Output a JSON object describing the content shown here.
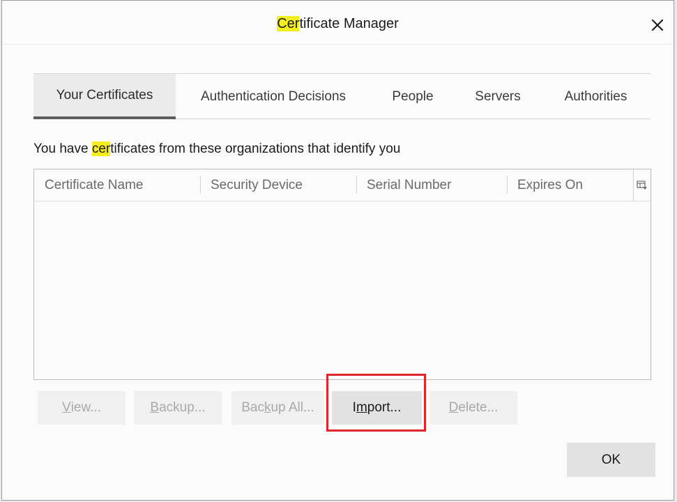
{
  "window": {
    "title_highlight": "Cer",
    "title_rest": "tificate Manager",
    "close_icon": "close-icon"
  },
  "tabs": [
    {
      "label": "Your Certificates",
      "active": true
    },
    {
      "label": "Authentication Decisions",
      "active": false
    },
    {
      "label": "People",
      "active": false
    },
    {
      "label": "Servers",
      "active": false
    },
    {
      "label": "Authorities",
      "active": false
    }
  ],
  "intro": {
    "before": "You have ",
    "highlight": "cer",
    "after": "tificates from these organizations that identify you"
  },
  "table": {
    "columns": [
      "Certificate Name",
      "Security Device",
      "Serial Number",
      "Expires On"
    ],
    "rows": [],
    "column_picker_icon": "column-picker-icon"
  },
  "buttons": {
    "view": {
      "pre": "",
      "key": "V",
      "post": "iew...",
      "enabled": false
    },
    "backup": {
      "pre": "",
      "key": "B",
      "post": "ackup...",
      "enabled": false
    },
    "backup_all": {
      "pre": "Bac",
      "key": "k",
      "post": "up All...",
      "enabled": false
    },
    "import": {
      "pre": "I",
      "key": "m",
      "post": "port...",
      "enabled": true
    },
    "delete": {
      "pre": "",
      "key": "D",
      "post": "elete...",
      "enabled": false
    }
  },
  "ok_label": "OK",
  "colors": {
    "highlight": "#f5ee1f",
    "annotation_box": "#e0262b"
  }
}
